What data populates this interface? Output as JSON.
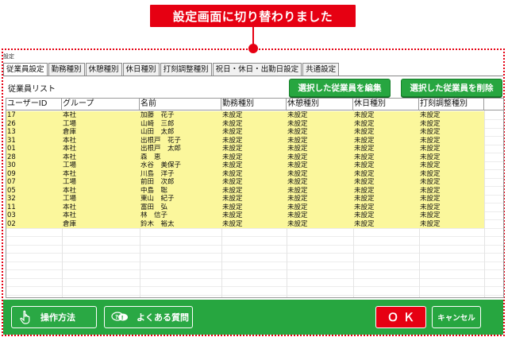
{
  "callout": {
    "text": "設定画面に切り替わりました"
  },
  "window": {
    "title": "設定"
  },
  "tabs": [
    {
      "label": "従業員設定",
      "active": true
    },
    {
      "label": "勤務種別",
      "active": false
    },
    {
      "label": "休憩種別",
      "active": false
    },
    {
      "label": "休日種別",
      "active": false
    },
    {
      "label": "打刻調整種別",
      "active": false
    },
    {
      "label": "祝日・休日・出勤日設定",
      "active": false
    },
    {
      "label": "共通設定",
      "active": false
    }
  ],
  "list": {
    "label": "従業員リスト",
    "edit_button": "選択した従業員を編集",
    "delete_button": "選択した従業員を削除",
    "columns": [
      "ユーザーID",
      "グループ",
      "名前",
      "勤務種別",
      "休憩種別",
      "休日種別",
      "打刻調整種別"
    ],
    "rows": [
      [
        "17",
        "本社",
        "加藤　花子",
        "未設定",
        "未設定",
        "未設定",
        "未設定"
      ],
      [
        "26",
        "工場",
        "山崎　三郎",
        "未設定",
        "未設定",
        "未設定",
        "未設定"
      ],
      [
        "13",
        "倉庫",
        "山田　太郎",
        "未設定",
        "未設定",
        "未設定",
        "未設定"
      ],
      [
        "31",
        "本社",
        "出根戸　花子",
        "未設定",
        "未設定",
        "未設定",
        "未設定"
      ],
      [
        "01",
        "本社",
        "出根戸　太郎",
        "未設定",
        "未設定",
        "未設定",
        "未設定"
      ],
      [
        "28",
        "本社",
        "森　恵",
        "未設定",
        "未設定",
        "未設定",
        "未設定"
      ],
      [
        "30",
        "工場",
        "水谷　美保子",
        "未設定",
        "未設定",
        "未設定",
        "未設定"
      ],
      [
        "09",
        "本社",
        "川島　洋子",
        "未設定",
        "未設定",
        "未設定",
        "未設定"
      ],
      [
        "07",
        "工場",
        "前田　次郎",
        "未設定",
        "未設定",
        "未設定",
        "未設定"
      ],
      [
        "05",
        "本社",
        "中島　聡",
        "未設定",
        "未設定",
        "未設定",
        "未設定"
      ],
      [
        "32",
        "工場",
        "東山　紀子",
        "未設定",
        "未設定",
        "未設定",
        "未設定"
      ],
      [
        "11",
        "本社",
        "富田　弘",
        "未設定",
        "未設定",
        "未設定",
        "未設定"
      ],
      [
        "03",
        "本社",
        "林　信子",
        "未設定",
        "未設定",
        "未設定",
        "未設定"
      ],
      [
        "02",
        "倉庫",
        "鈴木　裕太",
        "未設定",
        "未設定",
        "未設定",
        "未設定"
      ]
    ]
  },
  "footer": {
    "help_button": "操作方法",
    "faq_button": "よくある質問",
    "ok_button": "ＯＫ",
    "cancel_button": "キャンセル"
  },
  "colors": {
    "accent_red": "#e60012",
    "accent_green": "#27a640",
    "row_highlight": "#fbf79c"
  },
  "icons": {
    "help": "hand-pointer-icon",
    "faq": "speech-bubbles-icon"
  }
}
